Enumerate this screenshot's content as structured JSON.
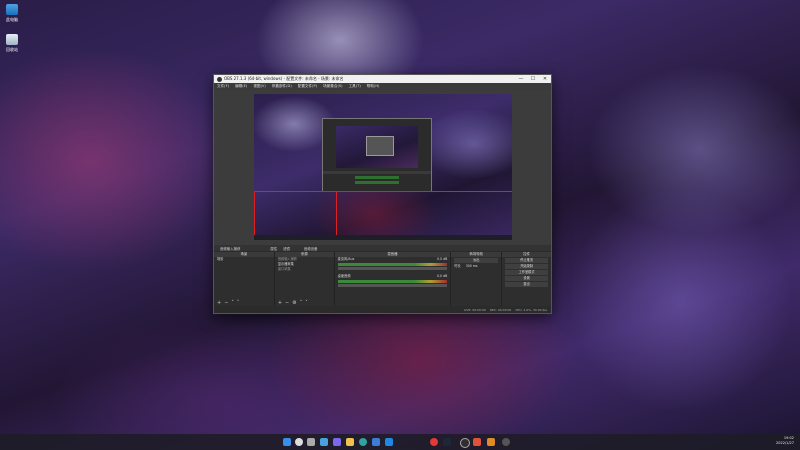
{
  "desktop": {
    "icons": [
      {
        "label": "此电脑",
        "icon": "computer-icon"
      },
      {
        "label": "回收站",
        "icon": "recycle-bin-icon"
      }
    ]
  },
  "obs": {
    "title": "OBS 27.1.3 (64-bit, windows) - 配置文件: 未命名 - 场景: 未命名",
    "menu": [
      "文件(F)",
      "编辑(E)",
      "视图(V)",
      "停靠部件(D)",
      "配置文件(P)",
      "场景集合(S)",
      "工具(T)",
      "帮助(H)"
    ],
    "dock_bar": {
      "source_label": "音频输入捕获",
      "properties": "属性",
      "filters": "滤镜",
      "extra": "音频设备"
    },
    "panels": {
      "scenes": {
        "title": "场景",
        "items": [
          "场景"
        ]
      },
      "sources": {
        "title": "来源",
        "items": [
          "音频输入捕获",
          "显示器采集",
          "窗口采集"
        ]
      },
      "mixer": {
        "title": "混音器",
        "channels": [
          {
            "name": "麦克风/Aux",
            "level": "0.0 dB"
          },
          {
            "name": "桌面音频",
            "level": "0.0 dB"
          }
        ]
      },
      "transitions": {
        "title": "转场特效",
        "type": "淡出",
        "duration_label": "时长",
        "duration_value": "300 ms"
      },
      "controls": {
        "title": "控件",
        "buttons": [
          "停止推流",
          "开始录制",
          "工作室模式",
          "设置",
          "退出"
        ]
      }
    },
    "status": [
      "LIVE: 00:00:00",
      "REC: 00:00:00",
      "CPU: 2.0%, 30.00 fps"
    ]
  },
  "taskbar": {
    "time": "19:02",
    "date": "2022/1/27",
    "apps": [
      "start-icon",
      "search-icon",
      "task-view-icon",
      "widgets-icon",
      "chat-icon",
      "explorer-icon",
      "edge-icon",
      "store-icon",
      "mail-icon",
      "chrome-icon",
      "steam-icon",
      "obs-icon",
      "settings-icon",
      "app-icon",
      "app-icon-2"
    ]
  },
  "colors": {
    "accent_red": "#e02020",
    "obs_bg": "#2b2b2b"
  }
}
